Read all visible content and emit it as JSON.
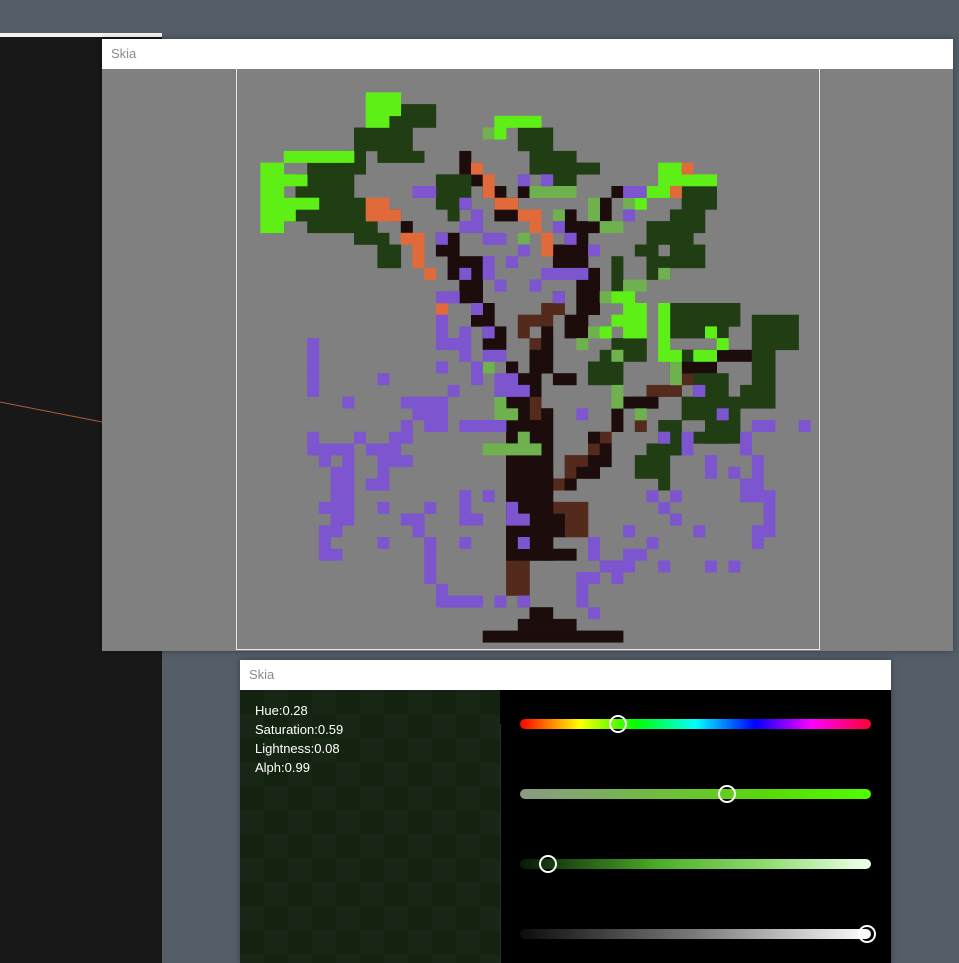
{
  "windows": {
    "canvas_title": "Skia",
    "picker_title": "Skia"
  },
  "picker": {
    "hue_label": "Hue:0.28",
    "saturation_label": "Saturation:0.59",
    "lightness_label": "Lightness:0.08",
    "alpha_label": "Alph:0.99",
    "values": {
      "hue": 0.28,
      "saturation": 0.59,
      "lightness": 0.08,
      "alpha": 0.99
    },
    "swatch_color": "#132310"
  },
  "colors": {
    "desktop": "#545d68",
    "canvas_bg": "#808080",
    "bright_green": "#5ef016",
    "dark_green": "#213d14",
    "mid_green": "#6fb04f",
    "trunk_dark": "#1c0c0c",
    "trunk_brown": "#532a1c",
    "orange": "#e06a3a",
    "purple": "#7c55cf"
  },
  "icons": {
    "hue_knob": "circle-knob-icon",
    "saturation_knob": "circle-knob-icon",
    "lightness_knob": "circle-knob-icon",
    "alpha_knob": "circle-knob-icon"
  }
}
